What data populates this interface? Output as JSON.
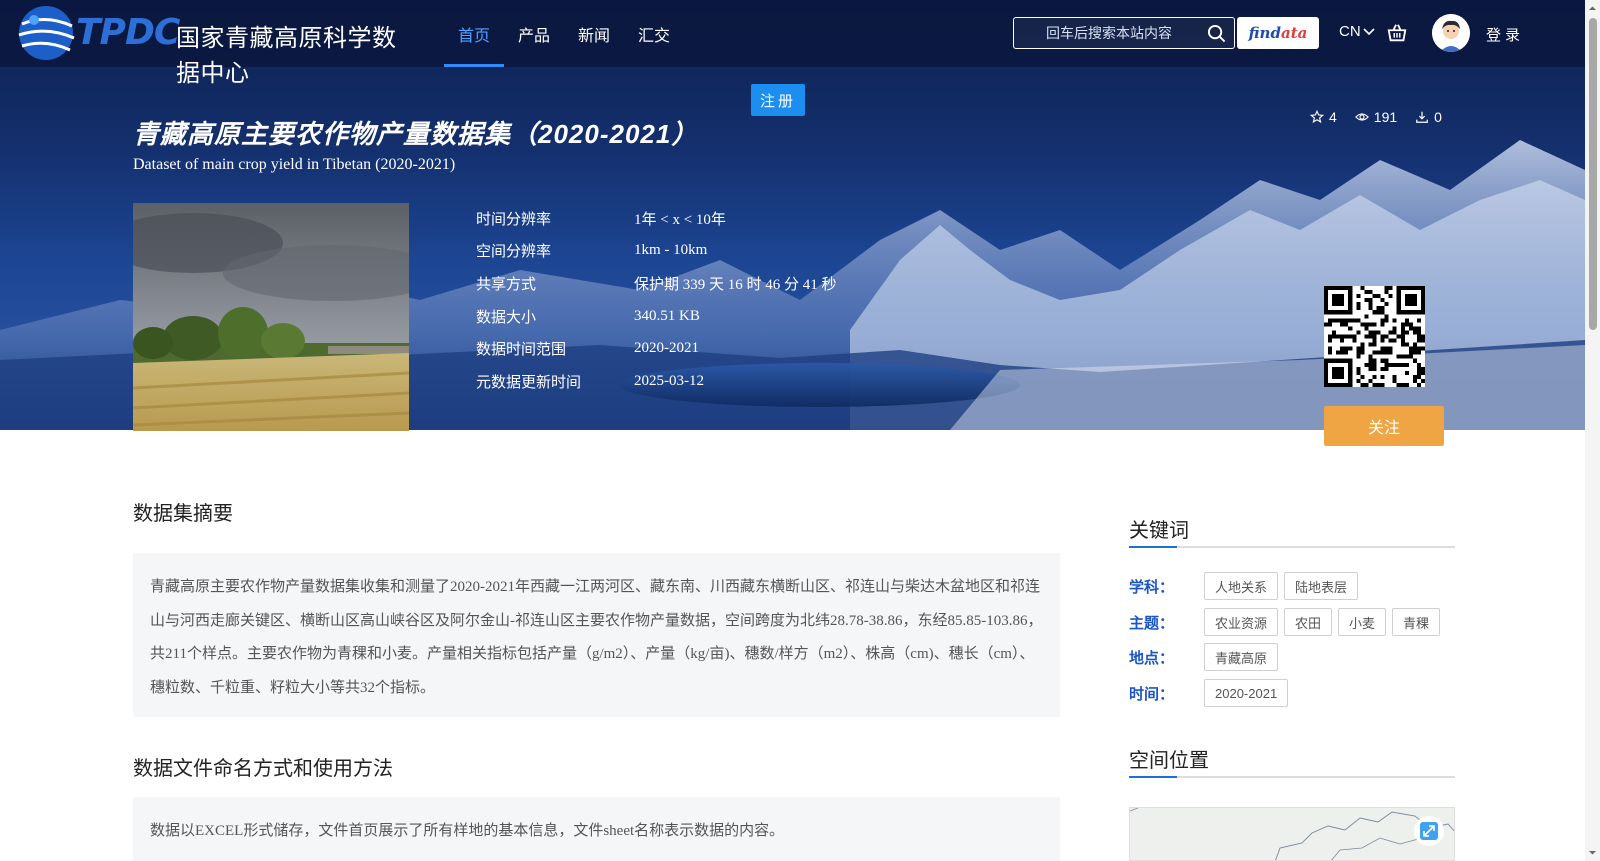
{
  "header": {
    "logo_text": "TPDC",
    "logo_cn": "国家青藏高原科学数据中心",
    "nav": [
      {
        "label": "首页",
        "active": true
      },
      {
        "label": "产品",
        "active": false
      },
      {
        "label": "新闻",
        "active": false
      },
      {
        "label": "汇交",
        "active": false
      }
    ],
    "search_placeholder": "回车后搜索本站内容",
    "findata_part1": "find",
    "findata_part2": "ata",
    "lang": "CN",
    "login": "登录"
  },
  "hero": {
    "register": "注册",
    "title_cn": "青藏高原主要农作物产量数据集（2020-2021）",
    "title_en": "Dataset of main crop yield in Tibetan (2020-2021)",
    "stats": {
      "stars": "4",
      "views": "191",
      "downloads": "0"
    },
    "meta": [
      {
        "key": "时间分辨率",
        "value": "1年 < x < 10年"
      },
      {
        "key": "空间分辨率",
        "value": "1km - 10km"
      },
      {
        "key": "共享方式",
        "value": "保护期 339 天 16 时 46 分 41 秒"
      },
      {
        "key": "数据大小",
        "value": "340.51 KB"
      },
      {
        "key": "数据时间范围",
        "value": "2020-2021"
      },
      {
        "key": "元数据更新时间",
        "value": "2025-03-12"
      }
    ],
    "follow": "关注"
  },
  "abstract": {
    "title": "数据集摘要",
    "text": "青藏高原主要农作物产量数据集收集和测量了2020-2021年西藏一江两河区、藏东南、川西藏东横断山区、祁连山与柴达木盆地区和祁连山与河西走廊关键区、横断山区高山峡谷区及阿尔金山-祁连山区主要农作物产量数据，空间跨度为北纬28.78-38.86，东经85.85-103.86，共211个样点。主要农作物为青稞和小麦。产量相关指标包括产量（g/m2）、产量（kg/亩)、穗数/样方（m2）、株高（cm)、穗长（cm）、穗粒数、千粒重、籽粒大小等共32个指标。"
  },
  "naming": {
    "title": "数据文件命名方式和使用方法",
    "text": "数据以EXCEL形式储存，文件首页展示了所有样地的基本信息，文件sheet名称表示数据的内容。"
  },
  "keywords": {
    "title": "关键词",
    "rows": [
      {
        "label": "学科：",
        "tags": [
          "人地关系",
          "陆地表层"
        ]
      },
      {
        "label": "主题：",
        "tags": [
          "农业资源",
          "农田",
          "小麦",
          "青稞"
        ]
      },
      {
        "label": "地点：",
        "tags": [
          "青藏高原"
        ]
      },
      {
        "label": "时间：",
        "tags": [
          "2020-2021"
        ]
      }
    ]
  },
  "location": {
    "title": "空间位置"
  },
  "colors": {
    "accent": "#1b8ef0",
    "follow": "#f0a544",
    "keyword_label": "#1b56c4"
  }
}
